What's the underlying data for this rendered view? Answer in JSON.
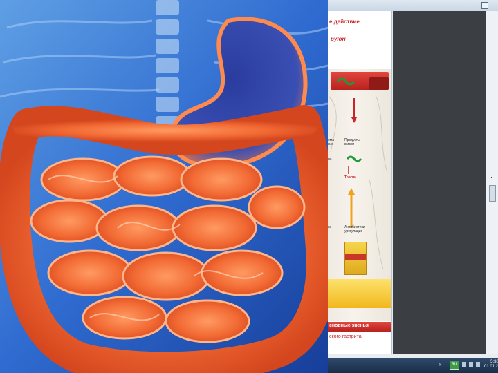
{
  "document": {
    "title_line1": "е действие",
    "title_line2": "pylori",
    "diagram_labels": {
      "left_top": "ема\nкие",
      "center_top": "Продукты\nжизни",
      "left_mid": "на",
      "center_mid": "Токсин",
      "left_low": "ка",
      "center_low": "Антибиотики\nурегулация"
    },
    "bottom_banner": "сновные звенья",
    "bottom_subtitle": "ского гастрита"
  },
  "taskbar": {
    "tray_arrows": "«",
    "language": "RU",
    "clock": "5:30\n01.01.2012"
  },
  "colors": {
    "accent_red": "#c8252b",
    "taskbar": "#1a2e48",
    "gray_panel": "#3b3f44"
  },
  "icons": {
    "anatomy": "intestines-illustration",
    "topbar": "window-square-icon",
    "thumb": "slide-thumbnail-icon"
  }
}
